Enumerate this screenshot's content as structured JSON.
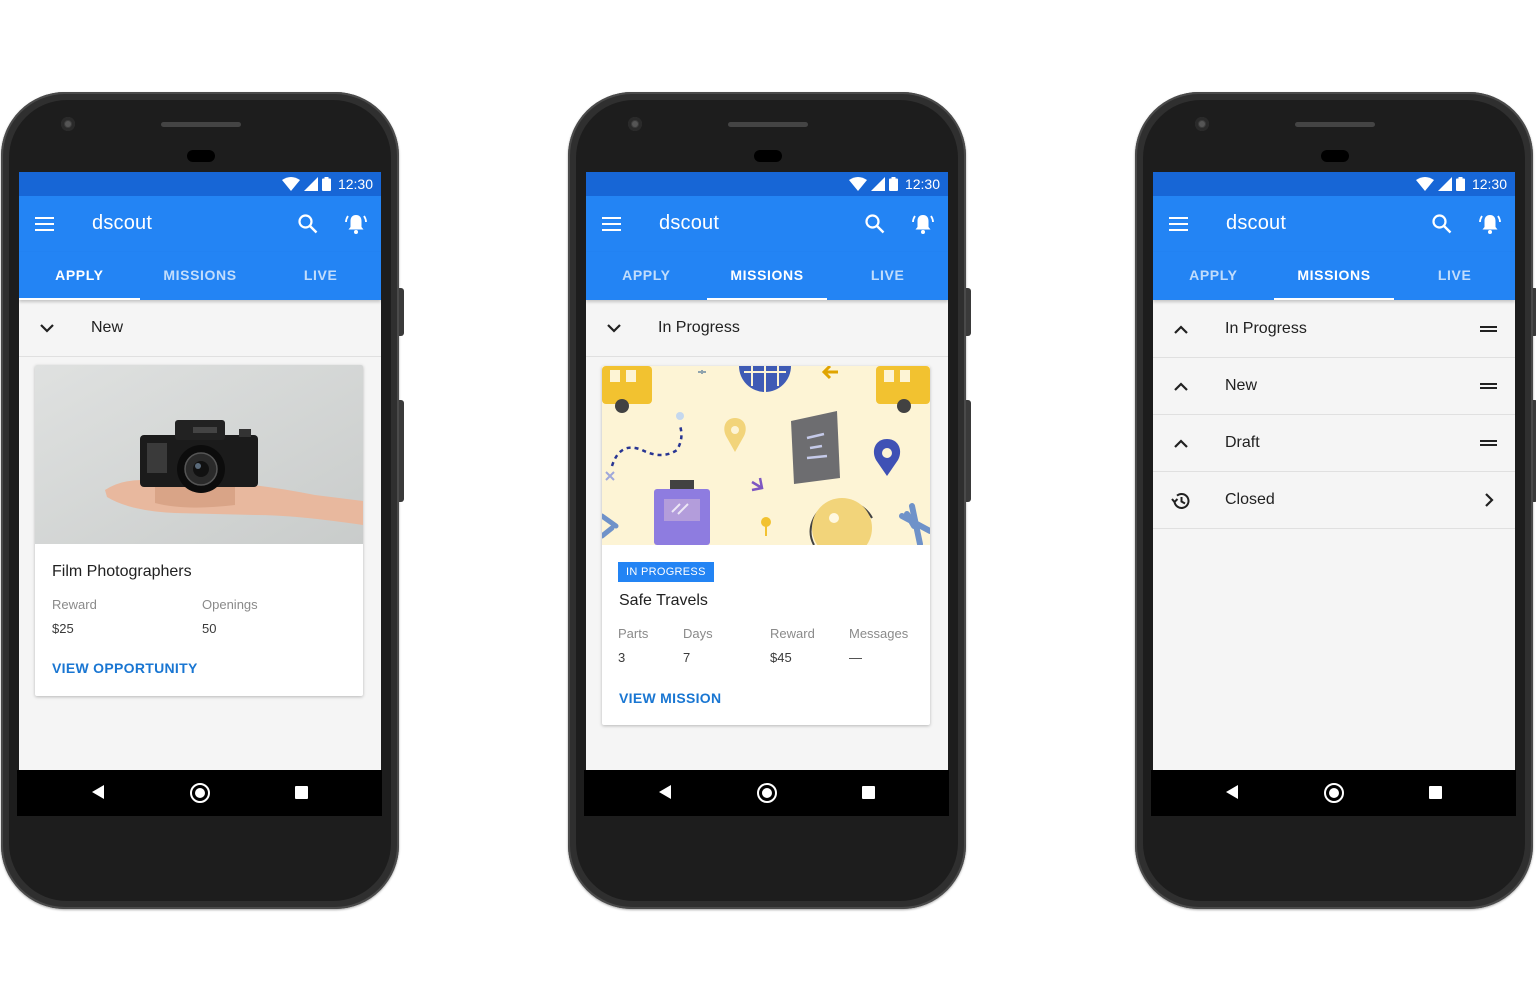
{
  "status_bar": {
    "time": "12:30"
  },
  "app": {
    "title": "dscout",
    "tabs": [
      "APPLY",
      "MISSIONS",
      "LIVE"
    ]
  },
  "phone1": {
    "active_tab": "APPLY",
    "section_label": "New",
    "card": {
      "title": "Film Photographers",
      "reward_label": "Reward",
      "reward_value": "$25",
      "openings_label": "Openings",
      "openings_value": "50",
      "action": "VIEW OPPORTUNITY"
    }
  },
  "phone2": {
    "active_tab": "MISSIONS",
    "section_label": "In Progress",
    "card": {
      "badge": "IN PROGRESS",
      "title": "Safe Travels",
      "parts_label": "Parts",
      "parts_value": "3",
      "days_label": "Days",
      "days_value": "7",
      "reward_label": "Reward",
      "reward_value": "$45",
      "messages_label": "Messages",
      "messages_value": "—",
      "action": "VIEW MISSION"
    }
  },
  "phone3": {
    "active_tab": "MISSIONS",
    "rows": [
      {
        "label": "In Progress",
        "lead_icon": "chevron-up-icon",
        "trail_icon": "drag-handle-icon"
      },
      {
        "label": "New",
        "lead_icon": "chevron-up-icon",
        "trail_icon": "drag-handle-icon"
      },
      {
        "label": "Draft",
        "lead_icon": "chevron-up-icon",
        "trail_icon": "drag-handle-icon"
      },
      {
        "label": "Closed",
        "lead_icon": "history-icon",
        "trail_icon": "chevron-right-icon"
      }
    ]
  },
  "colors": {
    "status_bar": "#1766d6",
    "app_bar": "#2384f4",
    "link": "#1976d2",
    "screen_bg": "#f5f5f5"
  }
}
